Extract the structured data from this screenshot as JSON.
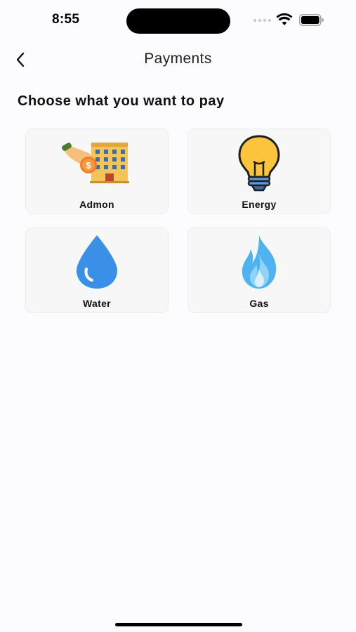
{
  "status_bar": {
    "time": "8:55"
  },
  "nav": {
    "title": "Payments",
    "back_icon": "chevron-left-icon"
  },
  "main": {
    "heading": "Choose what you want to pay",
    "options": [
      {
        "label": "Admon",
        "icon": "building-payment-icon"
      },
      {
        "label": "Energy",
        "icon": "lightbulb-icon"
      },
      {
        "label": "Water",
        "icon": "water-drop-icon"
      },
      {
        "label": "Gas",
        "icon": "gas-flame-icon"
      }
    ]
  },
  "colors": {
    "background": "#fcfbfe",
    "card": "#f7f7f7",
    "bulb": "#fcc43d",
    "water": "#3a8fe6",
    "gas": "#4fb3f0"
  }
}
